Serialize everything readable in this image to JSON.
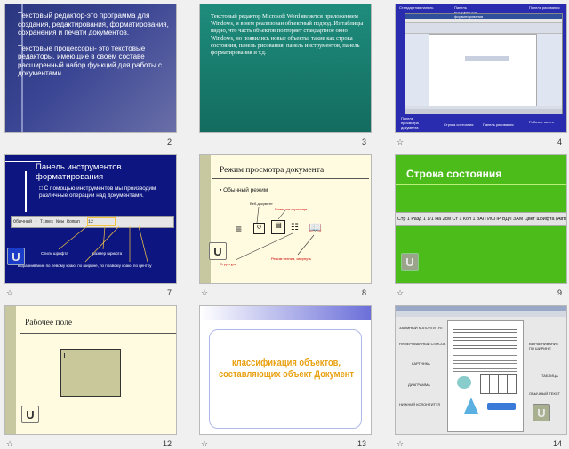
{
  "slides": [
    {
      "num": "2",
      "bullets": [
        "Текстовый редактор-это программа для создания, редактирования, форматирования, сохранения и печати документов.",
        "Текстовые процессоры- это текстовые редакторы, имеющие в своем составе расширенный набор функций для работы с документами."
      ]
    },
    {
      "num": "3",
      "text": "Текстовый редактор Microsoft Word является приложением Windows, и в нем реализован объектный подход. Из таблицы видно, что часть объектов повторяет стандартное окно Windows, но появились новые объекты, такие как строка состояния, панель рисования, панель инструментов, панель форматирования и т.д."
    },
    {
      "num": "4",
      "labels": [
        "Стандартная панель",
        "Панель инструментов форматирования",
        "Панель рисования",
        "Панель просмотра документа",
        "Строка состояния",
        "Панель рисования",
        "Рабочее место"
      ]
    },
    {
      "num": "7",
      "title": "Панель инструментов форматирования",
      "bullet": "С помощью инструментов мы производим различные операции над документами.",
      "cap1": "Стиль шрифта",
      "cap2": "размер шрифта",
      "cap3": "выравнивание по левому краю, по ширине, по правому краю, по центру",
      "toolbar": "Обычный • Times New Roman • 12"
    },
    {
      "num": "8",
      "title": "Режим просмотра документа",
      "bullet": "Обычный режим",
      "l1": "Веб-документ",
      "l2": "Разметка страницы",
      "l3": "Структура",
      "l4": "Режим чтения, свернуть"
    },
    {
      "num": "9",
      "title": "Строка состояния",
      "statusbar": "Стр 1   Разд 1   1/1   На 2см   Ст 1   Кол 1   ЗАП  ИСПР  ВДЛ  ЗАМ   Цвет шрифта (Авто)"
    },
    {
      "num": "12",
      "title": "Рабочее поле"
    },
    {
      "num": "13",
      "line1": "классификация объектов,",
      "line2": "составляющих объект Документ"
    },
    {
      "num": "14",
      "labels": [
        "ЗАЙМНЫЙ КОЛОНТИТУЛ",
        "НУМЕРОВАННЫЙ СПИСОК",
        "ВЫРАВНИВАНИЕ ПО ШИРИНЕ",
        "КАРТИНКА",
        "ТАБЛИЦА",
        "ДИАГРАММА",
        "ОБЫЧНЫЙ ТЕКСТ",
        "НИЖНИЙ КОЛОНТИТУЛ"
      ]
    }
  ],
  "colors": {
    "navy": "#1f2a6a",
    "teal": "#1a7a6e",
    "green": "#4cbc1a",
    "cream": "#fffbe0",
    "green_title": "#ffffff"
  }
}
